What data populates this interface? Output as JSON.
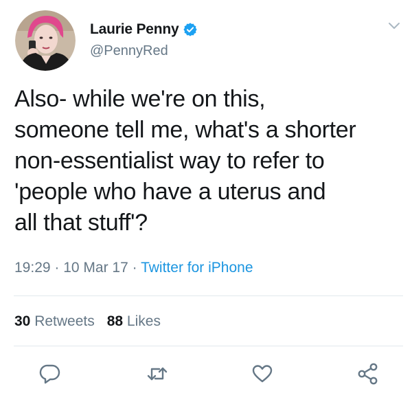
{
  "user": {
    "display_name": "Laurie Penny",
    "handle": "@PennyRed",
    "verified": true,
    "avatar_icon": "profile-photo"
  },
  "tweet": {
    "lines": [
      "Also- while we're on this,",
      "someone tell me, what's a shorter",
      "non-essentialist way to refer to",
      "'people who have a uterus and",
      "all that stuff'?"
    ]
  },
  "meta": {
    "time": "19:29",
    "separator1": " · ",
    "date": "10 Mar 17",
    "separator2": " · ",
    "source": "Twitter for iPhone"
  },
  "stats": {
    "retweets_count": "30",
    "retweets_label": " Retweets",
    "likes_count": "88",
    "likes_label": " Likes"
  },
  "actions": {
    "reply_icon": "reply-icon",
    "retweet_icon": "retweet-icon",
    "like_icon": "heart-icon",
    "share_icon": "share-icon"
  },
  "colors": {
    "text": "#14171a",
    "secondary": "#657786",
    "link": "#1b95e0",
    "verified": "#1da1f2",
    "divider": "#e1e8ed"
  }
}
